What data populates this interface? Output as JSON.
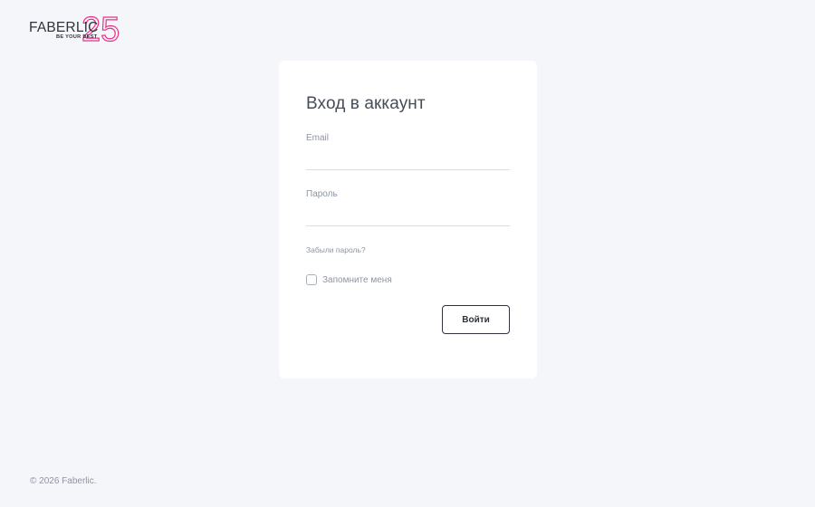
{
  "logo": {
    "brand": "FABERLIC",
    "number": "25",
    "tagline": "BE YOUR BEST"
  },
  "login_form": {
    "title": "Вход в аккаунт",
    "email_label": "Email",
    "email_value": "",
    "password_label": "Пароль",
    "password_value": "",
    "forgot_password": "Забыли пароль?",
    "remember_me": "Запомните меня",
    "remember_checked": false,
    "submit_label": "Войти"
  },
  "footer": {
    "copyright": "© 2026 Faberlic."
  },
  "colors": {
    "background": "#f5f6fa",
    "card": "#ffffff",
    "brand_pink": "#e8318a",
    "text_muted": "#8d94a3",
    "text_dark": "#2f333b"
  }
}
